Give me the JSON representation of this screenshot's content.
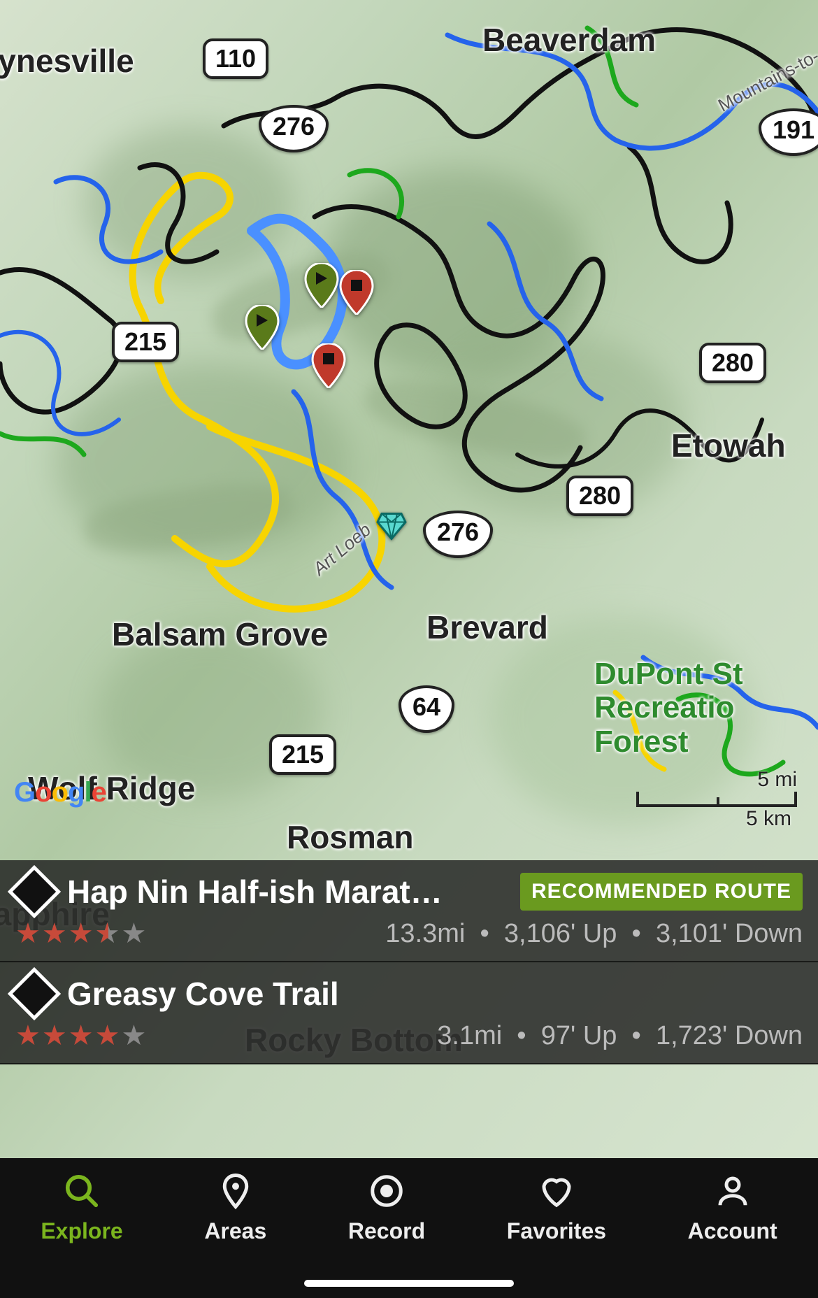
{
  "map": {
    "attribution": "Google",
    "scale": {
      "miles": "5 mi",
      "km": "5 km"
    },
    "places": {
      "waynesville": "Waynesville",
      "beaverdam": "Beaverdam",
      "etowah": "Etowah",
      "balsam_grove": "Balsam Grove",
      "brevard": "Brevard",
      "wolf_ridge": "Wolf Ridge",
      "rosman": "Rosman",
      "rocky_bottom": "Rocky Bottom",
      "sapphire": "Sapphire",
      "dupont": "DuPont St\nRecreatio\nForest",
      "mountains_to": "Mountains-to-",
      "art_loeb": "Art Loeb Tr"
    },
    "shields": {
      "nc110": "110",
      "us276_n": "276",
      "us276_s": "276",
      "nc215_n": "215",
      "nc215_s": "215",
      "nc280_e": "280",
      "nc280_w": "280",
      "us64": "64",
      "us191": "191"
    }
  },
  "trails": [
    {
      "name": "Hap Nin Half-ish Marat…",
      "difficulty": "black-diamond",
      "badge": "RECOMMENDED ROUTE",
      "rating": 3.5,
      "distance": "13.3mi",
      "ascent": "3,106' Up",
      "descent": "3,101' Down"
    },
    {
      "name": "Greasy Cove Trail",
      "difficulty": "black-diamond",
      "badge": null,
      "rating": 4.0,
      "distance": "3.1mi",
      "ascent": "97' Up",
      "descent": "1,723' Down"
    }
  ],
  "tabs": {
    "explore": "Explore",
    "areas": "Areas",
    "record": "Record",
    "favorites": "Favorites",
    "account": "Account"
  }
}
